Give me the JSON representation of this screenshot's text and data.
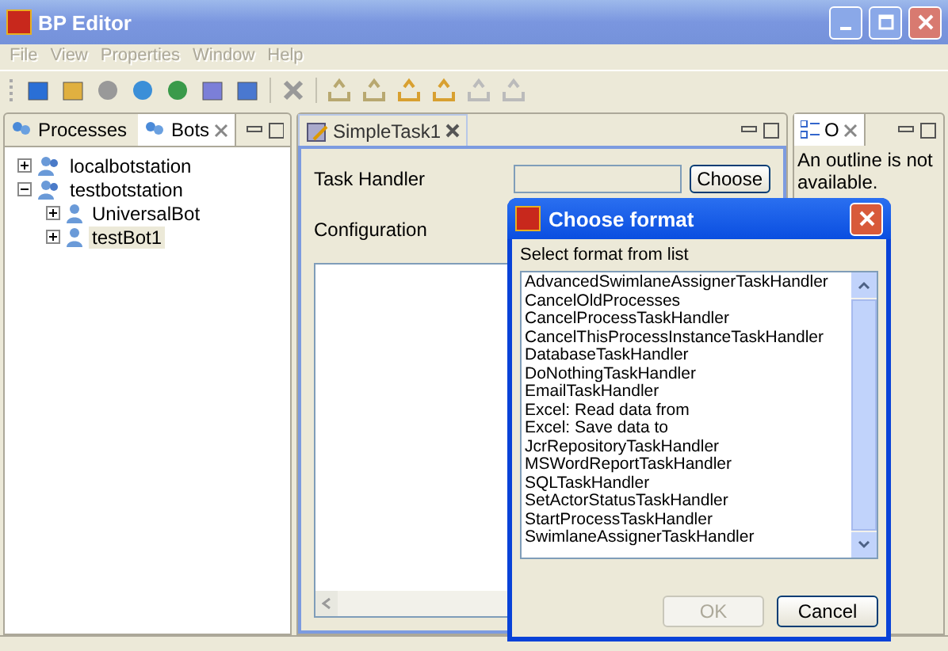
{
  "window": {
    "title": "BP Editor"
  },
  "menu": [
    {
      "label": "File",
      "disabled": true
    },
    {
      "label": "View",
      "disabled": true
    },
    {
      "label": "Properties",
      "disabled": true
    },
    {
      "label": "Window",
      "disabled": true
    },
    {
      "label": "Help",
      "disabled": true
    }
  ],
  "left_panel": {
    "tabs": [
      {
        "label": "Processes",
        "selected": false
      },
      {
        "label": "Bots",
        "selected": true
      }
    ],
    "tree": [
      {
        "label": "localbotstation",
        "kind": "station",
        "expanded": false,
        "selected": false
      },
      {
        "label": "testbotstation",
        "kind": "station",
        "expanded": true,
        "selected": false,
        "children": [
          {
            "label": "UniversalBot",
            "kind": "bot",
            "expanded": false,
            "selected": false
          },
          {
            "label": "testBot1",
            "kind": "bot",
            "expanded": false,
            "selected": true
          }
        ]
      }
    ]
  },
  "editor": {
    "tab": {
      "label": "SimpleTask1",
      "selected": true
    },
    "task_handler_label": "Task Handler",
    "choose_button": "Choose",
    "configuration_label": "Configuration"
  },
  "outline": {
    "tab": {
      "label": "O",
      "selected": true
    },
    "message": "An outline is not available."
  },
  "dialog": {
    "title": "Choose format",
    "prompt": "Select format from list",
    "items": [
      {
        "label": "AdvancedSwimlaneAssignerTaskHandler",
        "selected": false
      },
      {
        "label": "CancelOldProcesses",
        "selected": false
      },
      {
        "label": "CancelProcessTaskHandler",
        "selected": false
      },
      {
        "label": "CancelThisProcessInstanceTaskHandler",
        "selected": false
      },
      {
        "label": "DatabaseTaskHandler",
        "selected": false
      },
      {
        "label": "DoNothingTaskHandler",
        "selected": false
      },
      {
        "label": "EmailTaskHandler",
        "selected": false
      },
      {
        "label": "Excel: Read data from",
        "selected": false
      },
      {
        "label": "Excel: Save data to",
        "selected": false
      },
      {
        "label": "JcrRepositoryTaskHandler",
        "selected": false
      },
      {
        "label": "MSWordReportTaskHandler",
        "selected": false
      },
      {
        "label": "SQLTaskHandler",
        "selected": false
      },
      {
        "label": "SetActorStatusTaskHandler",
        "selected": false
      },
      {
        "label": "StartProcessTaskHandler",
        "selected": false
      },
      {
        "label": "SwimlaneAssignerTaskHandler",
        "selected": false
      }
    ],
    "buttons": [
      {
        "label": "OK",
        "disabled": true
      },
      {
        "label": "Cancel",
        "disabled": false
      }
    ]
  }
}
